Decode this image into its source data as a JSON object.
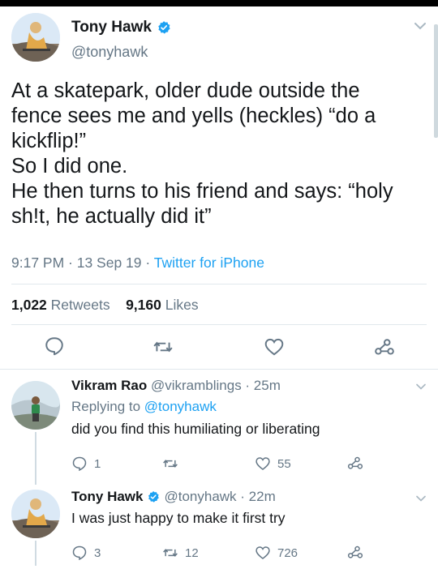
{
  "main_tweet": {
    "author_name": "Tony Hawk",
    "handle": "@tonyhawk",
    "text_lines": [
      "At a skatepark, older dude outside the",
      "fence sees me and yells (heckles) “do a",
      "kickflip!”",
      "So I did one.",
      "He then turns to his friend and says: “holy",
      "sh!t, he actually did it”"
    ],
    "time": "9:17 PM · 13 Sep 19 · ",
    "source": "Twitter for iPhone",
    "retweets_count": "1,022",
    "retweets_label": "Retweets",
    "likes_count": "9,160",
    "likes_label": "Likes"
  },
  "replies": [
    {
      "author_name": "Vikram Rao",
      "handle": "@vikramblings · 25m",
      "replying_prefix": "Replying to ",
      "replying_handle": "@tonyhawk",
      "text": "did you find this humiliating or liberating",
      "reply_count": "1",
      "retweet_count": "",
      "like_count": "55"
    },
    {
      "author_name": "Tony Hawk",
      "handle": "@tonyhawk · 22m",
      "text": "I was just happy to make it first try",
      "reply_count": "3",
      "retweet_count": "12",
      "like_count": "726"
    }
  ],
  "icons": {
    "reply": "reply-icon",
    "retweet": "retweet-icon",
    "like": "heart-icon",
    "share": "share-icon",
    "verified": "verified-badge-icon",
    "more": "chevron-down-icon"
  },
  "colors": {
    "link": "#1da1f2",
    "secondary_text": "#657786",
    "divider": "#e1e8ed",
    "icon_gray": "#657786"
  }
}
